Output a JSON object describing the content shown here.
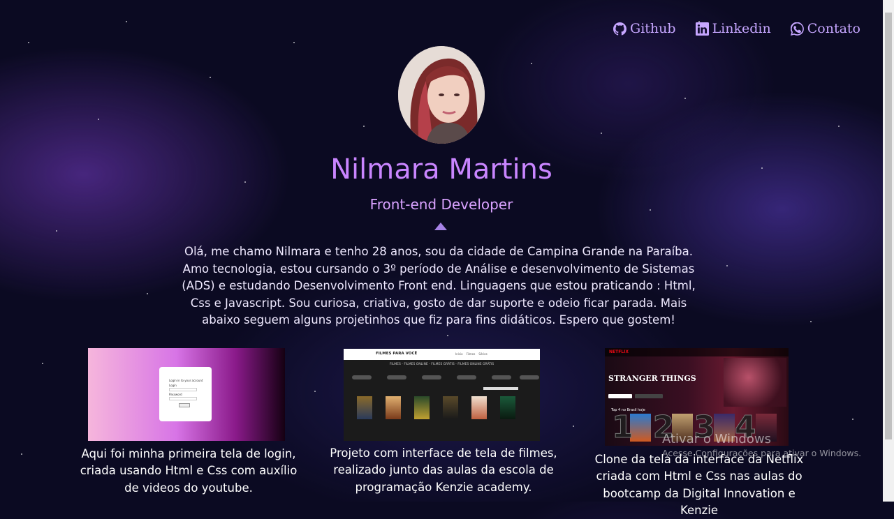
{
  "nav": {
    "github_label": "Github",
    "linkedin_label": "Linkedin",
    "contato_label": "Contato"
  },
  "profile": {
    "name": "Nilmara Martins",
    "role": "Front-end Developer",
    "intro": "Olá, me chamo Nilmara e tenho 28 anos, sou da cidade de Campina Grande na Paraíba. Amo tecnologia, estou cursando o 3º período de Análise e desenvolvimento de Sistemas (ADS) e estudando Desenvolvimento Front end. Linguagens que estou praticando : Html, Css e Javascript. Sou curiosa, criativa, gosto de dar suporte e odeio ficar parada. Mais abaixo seguem alguns projetinhos que fiz para fins didáticos. Espero que gostem!"
  },
  "projects": [
    {
      "caption": "Aqui foi minha primeira tela de login, criada usando Html e Css com auxílio de videos do youtube.",
      "login_title": "Login in to your account",
      "login_label": "Login",
      "password_label": "Password"
    },
    {
      "caption": "Projeto com interface de tela de filmes, realizado junto das aulas da escola de programação Kenzie academy.",
      "logo": "FILMES PARA VOCÊ",
      "banner": "FILMES - FILMES ONLINE - FILMES GRÁTIS - FILMES ONLINE GRÁTIS"
    },
    {
      "caption": "Clone da tela da interface da Netflix criada com Html e Css nas aulas do bootcamp da Digital Innovation e Kenzie",
      "brand": "NETFLIX",
      "show_title": "STRANGER THINGS",
      "row_title": "Top 4 no Brasil hoje"
    }
  ],
  "windows_watermark": {
    "line1": "Ativar o Windows",
    "line2": "Acesse Configurações para ativar o Windows."
  },
  "colors": {
    "accent": "#c985ff",
    "nav": "#c6a6ff",
    "background": "#0b0a22"
  }
}
